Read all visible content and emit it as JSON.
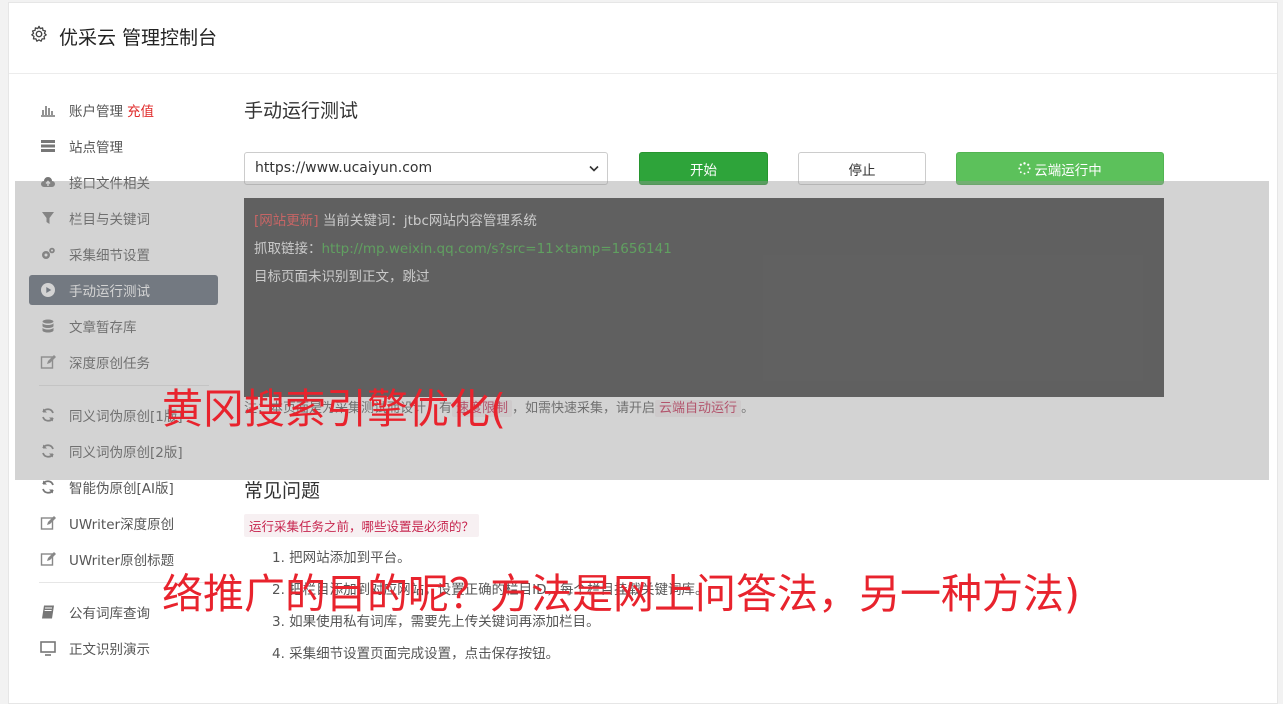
{
  "header": {
    "title": "优采云 管理控制台",
    "icon": "gear-icon"
  },
  "sidebar": {
    "items": [
      {
        "label": "账户管理",
        "badge": "充值",
        "icon": "bar-chart-icon"
      },
      {
        "label": "站点管理",
        "icon": "server-icon"
      },
      {
        "label": "接口文件相关",
        "icon": "cloud-upload-icon"
      },
      {
        "label": "栏目与关键词",
        "icon": "filter-icon"
      },
      {
        "label": "采集细节设置",
        "icon": "gears-icon"
      },
      {
        "label": "手动运行测试",
        "icon": "play-circle-icon",
        "active": true
      },
      {
        "label": "文章暂存库",
        "icon": "database-icon"
      },
      {
        "label": "深度原创任务",
        "icon": "edit-icon"
      },
      {
        "label": "同义词伪原创[1版]",
        "icon": "refresh-icon"
      },
      {
        "label": "同义词伪原创[2版]",
        "icon": "refresh-icon"
      },
      {
        "label": "智能伪原创[AI版]",
        "icon": "refresh-icon"
      },
      {
        "label": "UWriter深度原创",
        "icon": "edit-icon"
      },
      {
        "label": "UWriter原创标题",
        "icon": "edit-icon"
      },
      {
        "label": "公有词库查询",
        "icon": "book-icon"
      },
      {
        "label": "正文识别演示",
        "icon": "monitor-icon"
      }
    ]
  },
  "main": {
    "title": "手动运行测试",
    "url_select": "https://www.ucaiyun.com",
    "start_label": "开始",
    "stop_label": "停止",
    "cloud_label": "云端运行中",
    "console": {
      "line1_tag": "[网站更新]",
      "line1_text": " 当前关键词：jtbc网站内容管理系统",
      "line2_label": "抓取链接：",
      "line2_link": "http://mp.weixin.qq.com/s?src=11×tamp=1656141",
      "line3": "目标页面未识别到正文，跳过"
    },
    "notice": {
      "prefix": "注：本页面是为采集测试而设计，有",
      "tag1": "速度限制",
      "middle": "，如需快速采集，请开启",
      "tag2": "云端自动运行",
      "suffix": "。"
    },
    "faq": {
      "title": "常见问题",
      "question": "运行采集任务之前，哪些设置是必须的？",
      "items": [
        "1. 把网站添加到平台。",
        "2. 把栏目添加到对应网站，设置正确的栏目ID，每个栏目挂载关键词库。",
        "3. 如果使用私有词库，需要先上传关键词再添加栏目。",
        "4. 采集细节设置页面完成设置，点击保存按钮。"
      ]
    }
  },
  "watermark": {
    "line1": "黄冈搜索引擎优化(",
    "line2": "络推广的目的呢？方法是网上问答法，另一种方法)"
  }
}
